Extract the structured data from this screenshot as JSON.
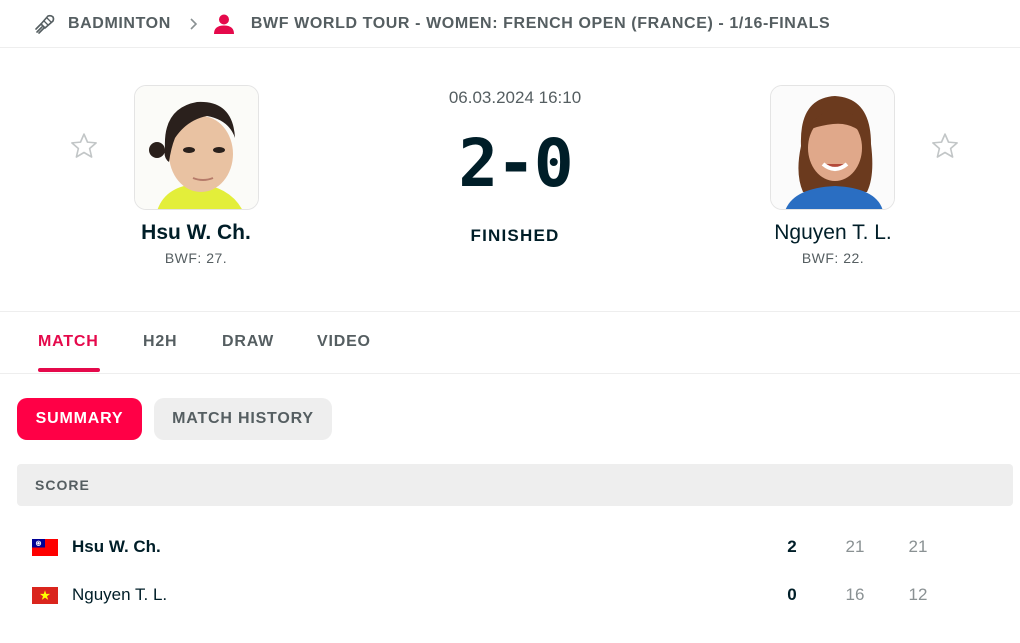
{
  "breadcrumb": {
    "sport": "BADMINTON",
    "tournament": "BWF WORLD TOUR - WOMEN: FRENCH OPEN (FRANCE) - 1/16-FINALS"
  },
  "match": {
    "datetime": "06.03.2024 16:10",
    "score": "2-0",
    "status": "FINISHED"
  },
  "home": {
    "name": "Hsu W. Ch.",
    "rank": "BWF: 27."
  },
  "away": {
    "name": "Nguyen T. L.",
    "rank": "BWF: 22."
  },
  "tabs": [
    "MATCH",
    "H2H",
    "DRAW",
    "VIDEO"
  ],
  "subtabs": [
    "SUMMARY",
    "MATCH HISTORY"
  ],
  "score_section": {
    "title": "SCORE",
    "rows": [
      {
        "name": "Hsu W. Ch.",
        "total": "2",
        "set1": "21",
        "set2": "21"
      },
      {
        "name": "Nguyen T. L.",
        "total": "0",
        "set1": "16",
        "set2": "12"
      }
    ]
  },
  "colors": {
    "accent": "#e5094b",
    "pill_active": "#ff0046",
    "text_dark": "#001e28",
    "text_muted": "#555e61"
  }
}
